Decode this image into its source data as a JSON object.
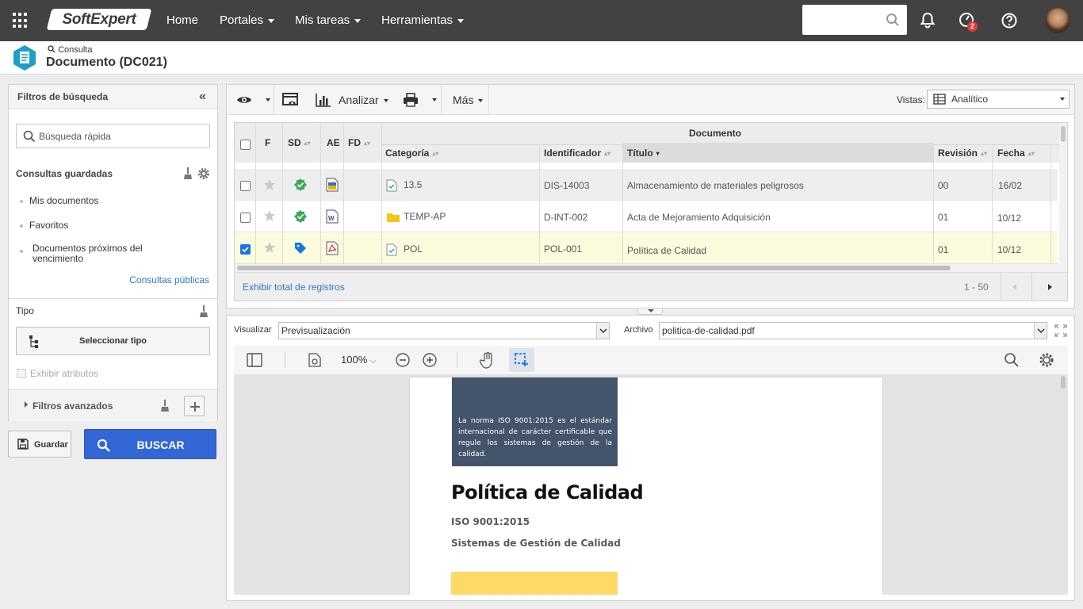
{
  "topbar": {
    "logo": "SoftExpert",
    "nav": [
      "Home",
      "Portales",
      "Mis tareas",
      "Herramientas"
    ],
    "notification_count": "2"
  },
  "header": {
    "crumb": "Consulta",
    "title": "Documento (DC021)"
  },
  "filters": {
    "title": "Filtros de búsqueda",
    "quick_search_placeholder": "Búsqueda rápida",
    "saved_title": "Consultas guardadas",
    "saved_items": [
      "Mis documentos",
      "Favoritos",
      "Documentos próximos del vencimiento"
    ],
    "public_link": "Consultas públicas",
    "type_title": "Tipo",
    "select_type": "Seleccionar tipo",
    "show_attributes": "Exhibir atributos",
    "advanced": "Filtros avanzados",
    "save": "Guardar",
    "search": "BUSCAR"
  },
  "toolbar": {
    "analyze": "Analizar",
    "more": "Más",
    "views_label": "Vistas:",
    "views_value": "Analítico"
  },
  "grid": {
    "group_header": "Documento",
    "columns": [
      "F",
      "SD",
      "AE",
      "FD",
      "Categoría",
      "Identificador",
      "Título",
      "Revisión",
      "Fecha"
    ],
    "rows": [
      {
        "categoria": "13.5",
        "identificador": "DIS-14003",
        "titulo": "Almacenamiento de materiales peligrosos",
        "revision": "00",
        "fecha": "16/02",
        "checked": false
      },
      {
        "categoria": "TEMP-AP",
        "identificador": "D-INT-002",
        "titulo": "Acta de Mejoramiento Adquisición",
        "revision": "01",
        "fecha": "10/12",
        "checked": false
      },
      {
        "categoria": "POL",
        "identificador": "POL-001",
        "titulo": "Política de Calidad",
        "revision": "01",
        "fecha": "10/12",
        "checked": true
      }
    ],
    "show_total": "Exhibir total de registros",
    "range": "1 - 50"
  },
  "preview": {
    "view_label": "Visualizar",
    "view_value": "Previsualización",
    "file_label": "Archivo",
    "file_value": "politica-de-calidad.pdf",
    "zoom": "100%",
    "pdf_box_text": "La norma ISO 9001:2015 es el estándar internacional de carácter certificable que regule los sistemas de gestión de la calidad.",
    "pdf_title": "Política de Calidad",
    "pdf_line1": "ISO 9001:2015",
    "pdf_line2": "Sistemas de Gestión de Calidad"
  },
  "colors": {
    "topbar": "#424242",
    "accent_blue": "#3367d6",
    "link": "#2f78c4",
    "selected_row": "#fbfbde",
    "pdf_box": "#44546a",
    "pdf_yellow": "#ffd966",
    "status_green": "#3aa757"
  }
}
